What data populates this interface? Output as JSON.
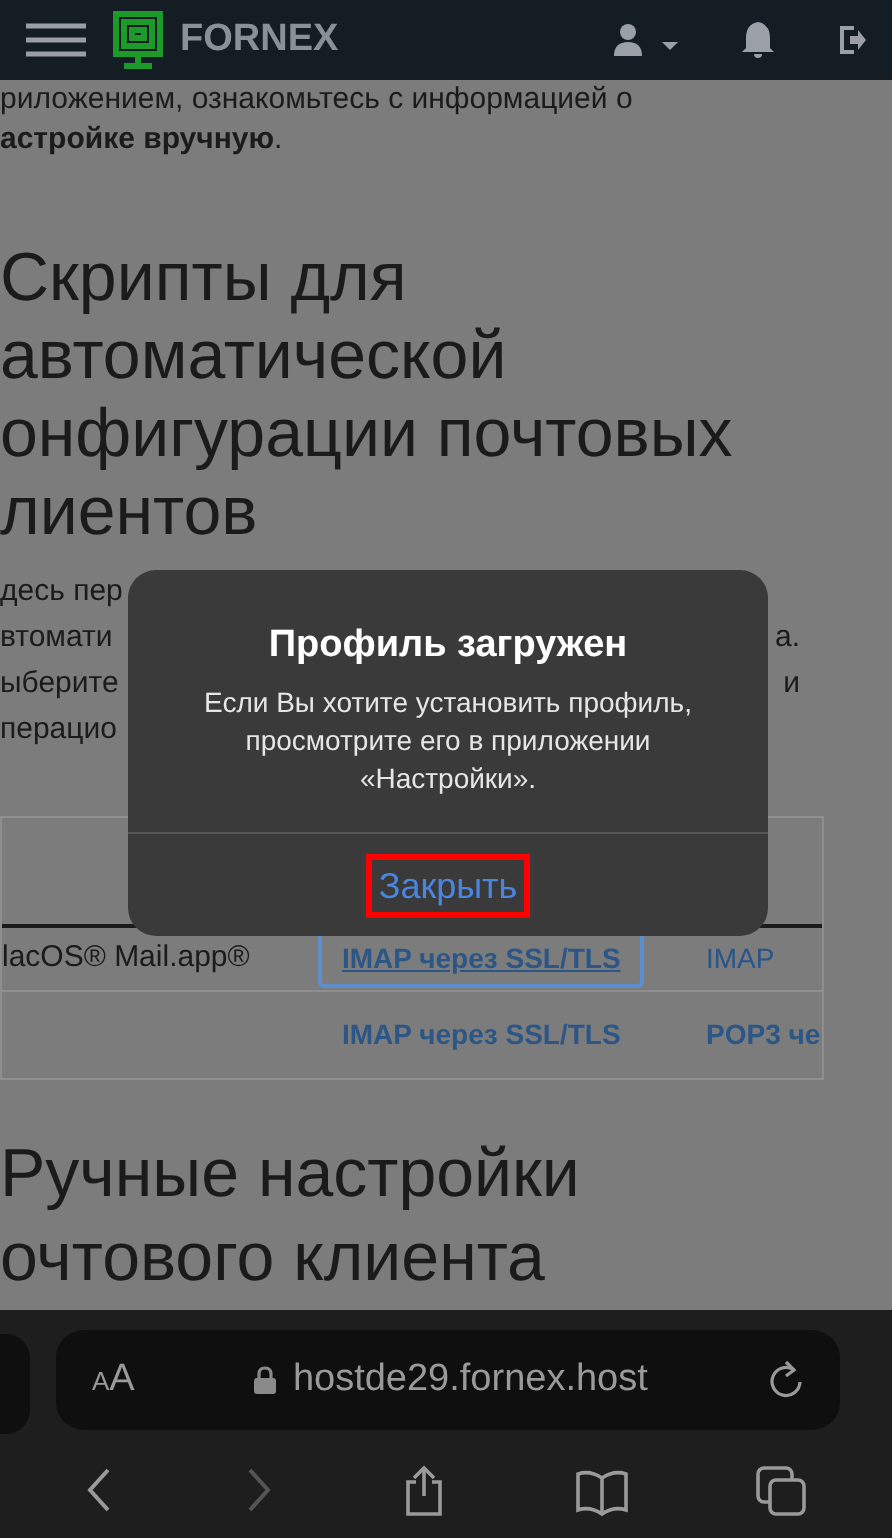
{
  "header": {
    "logo_text": "FORNEX"
  },
  "intro_lines": [
    "риложением, ознакомьтесь с информацией о",
    "**астройке вручную**."
  ],
  "heading_lines": [
    "Скрипты для",
    "автоматической",
    "онфигурации почтовых",
    "лиентов"
  ],
  "paragraph_fragments": [
    {
      "left": "десь пер"
    },
    {
      "left": "втомати",
      "right": "а."
    },
    {
      "left": "ыберите",
      "right": "и"
    },
    {
      "left": "перацио"
    }
  ],
  "table": {
    "rows": [
      {
        "label": "lacOS® Mail.app®",
        "links": [
          {
            "text": "IMAP через SSL/TLS",
            "kind": "bold",
            "focused": true
          },
          {
            "text": "IMAP",
            "kind": "light",
            "focused": false
          }
        ]
      },
      {
        "links": [
          {
            "text": "IMAP через SSL/TLS",
            "kind": "bold",
            "focused": false
          },
          {
            "text": "POP3 че",
            "kind": "bold",
            "focused": false
          }
        ]
      }
    ]
  },
  "heading2_lines": [
    "Ручные настройки",
    "очтового клиента"
  ],
  "dialog": {
    "title": "Профиль загружен",
    "message": "Если Вы хотите установить профиль, просмотрите его в приложении «Настройки».",
    "button": {
      "label": "Закрыть",
      "highlighted": true
    }
  },
  "browser": {
    "text_size_label": "AA",
    "address": "hostde29.fornex.host",
    "toolbar": [
      {
        "kind": "back",
        "disabled": false
      },
      {
        "kind": "forward",
        "disabled": true
      },
      {
        "kind": "share",
        "disabled": false
      },
      {
        "kind": "bookmarks",
        "disabled": false
      },
      {
        "kind": "tabs",
        "disabled": false
      }
    ]
  }
}
